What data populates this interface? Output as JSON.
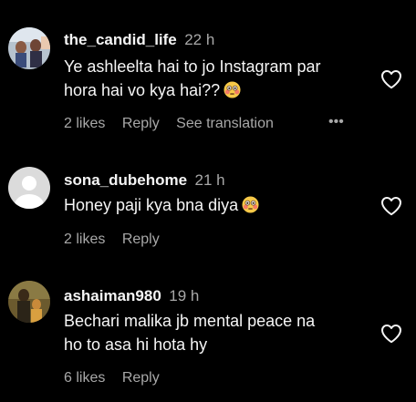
{
  "comments": [
    {
      "username": "the_candid_life",
      "time": "22 h",
      "line1": "Ye ashleelta hai to jo Instagram par",
      "line2": "hora hai vo kya hai??",
      "likes": "2 likes",
      "reply": "Reply",
      "translate": "See translation",
      "more": "•••",
      "emoji": "flushed-face-emoji",
      "avatar": "photo-avatar"
    },
    {
      "username": "sona_dubehome",
      "time": "21 h",
      "line1": "Honey paji kya bna diya",
      "likes": "2 likes",
      "reply": "Reply",
      "emoji": "flushed-face-emoji",
      "avatar": "default-avatar"
    },
    {
      "username": "ashaiman980",
      "time": "19 h",
      "line1": "Bechari malika jb mental peace na",
      "line2": "ho to asa hi hota hy",
      "likes": "6 likes",
      "reply": "Reply",
      "avatar": "photo-avatar"
    }
  ],
  "icons": {
    "like": "heart-outline-icon"
  },
  "colors": {
    "background": "#000000",
    "text": "#f5f5f5",
    "secondary": "#a8a8a8"
  }
}
